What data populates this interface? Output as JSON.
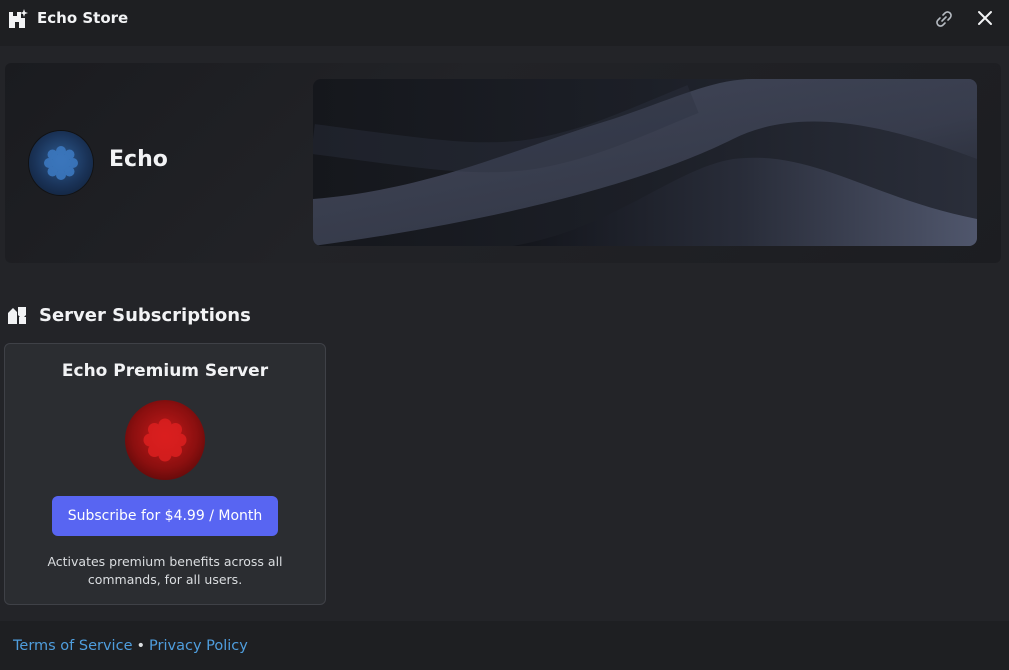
{
  "window": {
    "title": "Echo Store",
    "store_icon": "store-sparkle-icon",
    "link_icon": "link-icon",
    "close_icon": "close-icon"
  },
  "hero": {
    "app_name": "Echo",
    "avatar_icon": "echo-avatar-icon",
    "banner_image": "abstract-wave-banner"
  },
  "subscriptions": {
    "section_icon": "shapes-icon",
    "heading": "Server Subscriptions",
    "items": [
      {
        "title": "Echo Premium Server",
        "icon": "premium-server-icon",
        "button_label": "Subscribe for $4.99 / Month",
        "description": "Activates premium benefits across all commands, for all users."
      }
    ]
  },
  "footer": {
    "terms_label": "Terms of Service",
    "separator": "•",
    "privacy_label": "Privacy Policy"
  },
  "colors": {
    "background": "#1e1f22",
    "content_background": "#232428",
    "card_background": "#2b2d31",
    "accent_button": "#5865f2",
    "link": "#4f9ede"
  }
}
